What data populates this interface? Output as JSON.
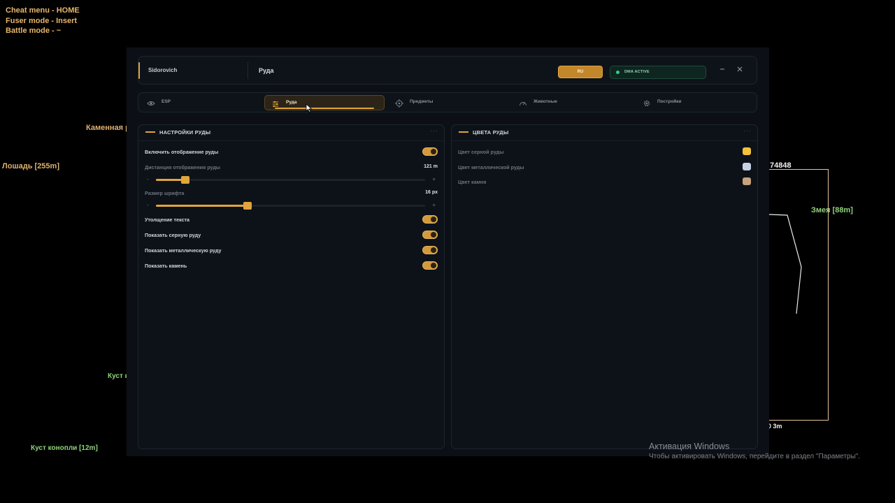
{
  "hotkeys": [
    "Cheat menu - HOME",
    "Fuser mode - Insert",
    "Battle mode - ~"
  ],
  "overlay": {
    "stone_label": "Каменная р",
    "horse_label": "Лошадь [255m]",
    "bush_label_left": "Куст к",
    "bush_label_bottom": "Куст конопли [12m]",
    "id_label": "74848",
    "snake_label": "Змея [88m]",
    "dist_label": "0 3m",
    "colors": {
      "orange": "#e0b070",
      "green": "#8fd17a",
      "box": "#e7c59a"
    }
  },
  "header": {
    "username": "Sidorovich",
    "section": "Руда",
    "lang_button": "RU",
    "status": "DMA ACTIVE",
    "minimize_icon": "minimize-icon",
    "close_icon": "close-icon"
  },
  "tabs": [
    {
      "label": "ESP",
      "icon": "eye-icon"
    },
    {
      "label": "Руда",
      "icon": "sliders-icon",
      "active": true
    },
    {
      "label": "Предметы",
      "icon": "crosshair-icon"
    },
    {
      "label": "Животные",
      "icon": "gauge-icon"
    },
    {
      "label": "Постройки",
      "icon": "gear-icon"
    }
  ],
  "ore_settings": {
    "title": "НАСТРОЙКИ РУДЫ",
    "enable_label": "Включить отображение руды",
    "enable_on": true,
    "distance_label": "Дистанция отображения руды",
    "distance_value": "121 m",
    "distance_fraction": 0.11,
    "font_label": "Размер шрифта",
    "font_value": "16 px",
    "font_fraction": 0.34,
    "minus": "-",
    "plus": "+",
    "bold_label": "Утолщение текста",
    "sulfur_label": "Показать серную руду",
    "metal_label": "Показать металлическую руду",
    "stone_label": "Показать камень"
  },
  "ore_colors": {
    "title": "ЦВЕТА РУДЫ",
    "sulfur_label": "Цвет серной руды",
    "sulfur_color": "#f2c23a",
    "metal_label": "Цвет металлической руды",
    "metal_color": "#c6d2e4",
    "stone_label": "Цвет камня",
    "stone_color": "#c7a37c"
  },
  "more_glyph": "···",
  "accent_color": "#e0a53c",
  "windows": {
    "activation_title": "Активация Windows",
    "activation_text": "Чтобы активировать Windows, перейдите в раздел \"Параметры\"."
  }
}
